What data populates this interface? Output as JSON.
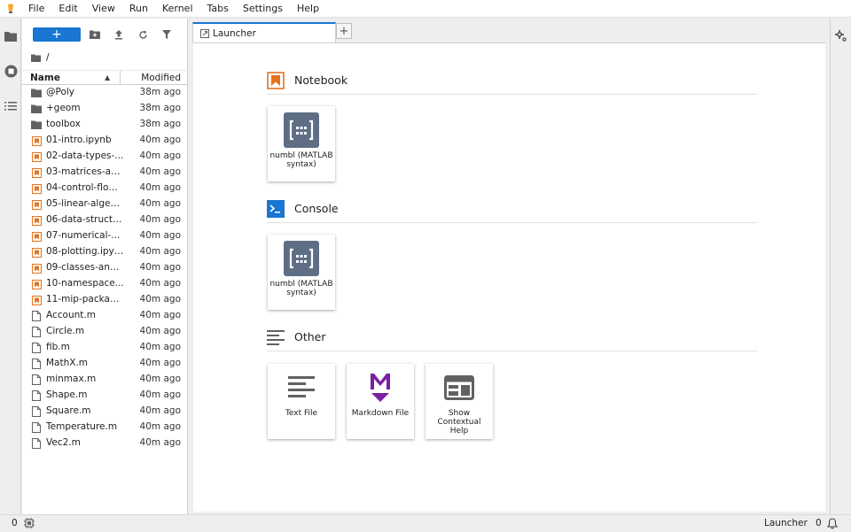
{
  "menu": [
    "File",
    "Edit",
    "View",
    "Run",
    "Kernel",
    "Tabs",
    "Settings",
    "Help"
  ],
  "file_browser": {
    "new_button": "+",
    "breadcrumb": "/",
    "headers": {
      "name": "Name",
      "modified": "Modified"
    },
    "files": [
      {
        "name": "@Poly",
        "modified": "38m ago",
        "type": "folder"
      },
      {
        "name": "+geom",
        "modified": "38m ago",
        "type": "folder"
      },
      {
        "name": "toolbox",
        "modified": "38m ago",
        "type": "folder"
      },
      {
        "name": "01-intro.ipynb",
        "modified": "40m ago",
        "type": "notebook"
      },
      {
        "name": "02-data-types-...",
        "modified": "40m ago",
        "type": "notebook"
      },
      {
        "name": "03-matrices-an...",
        "modified": "40m ago",
        "type": "notebook"
      },
      {
        "name": "04-control-flow-...",
        "modified": "40m ago",
        "type": "notebook"
      },
      {
        "name": "05-linear-algeb...",
        "modified": "40m ago",
        "type": "notebook"
      },
      {
        "name": "06-data-structu...",
        "modified": "40m ago",
        "type": "notebook"
      },
      {
        "name": "07-numerical-...",
        "modified": "40m ago",
        "type": "notebook"
      },
      {
        "name": "08-plotting.ipynb",
        "modified": "40m ago",
        "type": "notebook"
      },
      {
        "name": "09-classes-and-...",
        "modified": "40m ago",
        "type": "notebook"
      },
      {
        "name": "10-namespace...",
        "modified": "40m ago",
        "type": "notebook"
      },
      {
        "name": "11-mip-packag...",
        "modified": "40m ago",
        "type": "notebook"
      },
      {
        "name": "Account.m",
        "modified": "40m ago",
        "type": "file"
      },
      {
        "name": "Circle.m",
        "modified": "40m ago",
        "type": "file"
      },
      {
        "name": "fib.m",
        "modified": "40m ago",
        "type": "file"
      },
      {
        "name": "MathX.m",
        "modified": "40m ago",
        "type": "file"
      },
      {
        "name": "minmax.m",
        "modified": "40m ago",
        "type": "file"
      },
      {
        "name": "Shape.m",
        "modified": "40m ago",
        "type": "file"
      },
      {
        "name": "Square.m",
        "modified": "40m ago",
        "type": "file"
      },
      {
        "name": "Temperature.m",
        "modified": "40m ago",
        "type": "file"
      },
      {
        "name": "Vec2.m",
        "modified": "40m ago",
        "type": "file"
      }
    ]
  },
  "tab": {
    "label": "Launcher",
    "add": "+"
  },
  "launcher": {
    "notebook": {
      "title": "Notebook",
      "card_label": "numbl (MATLAB syntax)"
    },
    "console": {
      "title": "Console",
      "card_label": "numbl (MATLAB syntax)"
    },
    "other": {
      "title": "Other",
      "cards": [
        "Text File",
        "Markdown File",
        "Show Contextual Help"
      ]
    }
  },
  "status": {
    "count_left": "0",
    "mode": "Launcher",
    "count_right": "0"
  },
  "colors": {
    "accent": "#1976d2",
    "notebook_orange": "#e37420",
    "kernel_tile": "#5d6e85",
    "markdown_purple": "#7b1fa2"
  }
}
